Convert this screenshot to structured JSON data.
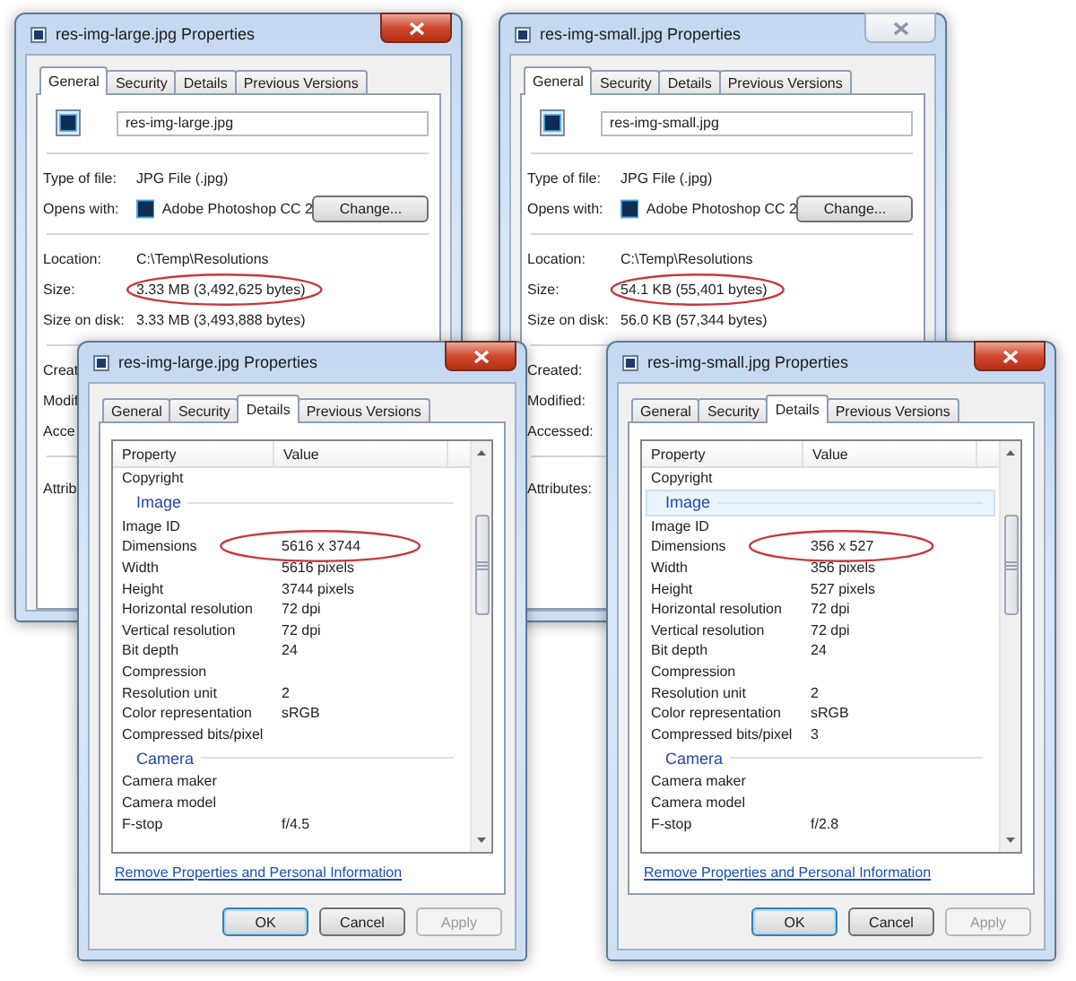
{
  "windows": [
    {
      "kind": "general",
      "title": "res-img-large.jpg Properties",
      "active": true,
      "tabs": [
        {
          "label": "General",
          "selected": true
        },
        {
          "label": "Security",
          "selected": false
        },
        {
          "label": "Details",
          "selected": false
        },
        {
          "label": "Previous Versions",
          "selected": false
        }
      ],
      "file_name": "res-img-large.jpg",
      "sections": [
        {
          "rows": [
            {
              "kind": "text",
              "label": "Type of file:",
              "value": "JPG File (.jpg)",
              "circled": false
            },
            {
              "kind": "app",
              "label": "Opens with:",
              "value": "Adobe Photoshop CC 2",
              "button": "Change..."
            }
          ]
        },
        {
          "rows": [
            {
              "kind": "text",
              "label": "Location:",
              "value": "C:\\Temp\\Resolutions",
              "circled": false
            },
            {
              "kind": "text",
              "label": "Size:",
              "value": "3.33 MB (3,492,625 bytes)",
              "circled": true
            },
            {
              "kind": "text",
              "label": "Size on disk:",
              "value": "3.33 MB (3,493,888 bytes)",
              "circled": false
            }
          ]
        },
        {
          "rows": [
            {
              "kind": "label",
              "label": "Creat"
            },
            {
              "kind": "label",
              "label": "Modif"
            },
            {
              "kind": "label",
              "label": "Acce"
            }
          ]
        },
        {
          "rows": [
            {
              "kind": "label",
              "label": "Attrib"
            }
          ]
        }
      ]
    },
    {
      "kind": "general",
      "title": "res-img-small.jpg Properties",
      "active": false,
      "tabs": [
        {
          "label": "General",
          "selected": true
        },
        {
          "label": "Security",
          "selected": false
        },
        {
          "label": "Details",
          "selected": false
        },
        {
          "label": "Previous Versions",
          "selected": false
        }
      ],
      "file_name": "res-img-small.jpg",
      "sections": [
        {
          "rows": [
            {
              "kind": "text",
              "label": "Type of file:",
              "value": "JPG File (.jpg)",
              "circled": false
            },
            {
              "kind": "app",
              "label": "Opens with:",
              "value": "Adobe Photoshop CC 2",
              "button": "Change..."
            }
          ]
        },
        {
          "rows": [
            {
              "kind": "text",
              "label": "Location:",
              "value": "C:\\Temp\\Resolutions",
              "circled": false
            },
            {
              "kind": "text",
              "label": "Size:",
              "value": "54.1 KB (55,401 bytes)",
              "circled": true
            },
            {
              "kind": "text",
              "label": "Size on disk:",
              "value": "56.0 KB (57,344 bytes)",
              "circled": false
            }
          ]
        },
        {
          "rows": [
            {
              "kind": "label",
              "label": "Created:"
            },
            {
              "kind": "label",
              "label": "Modified:"
            },
            {
              "kind": "label",
              "label": "Accessed:"
            }
          ]
        },
        {
          "rows": [
            {
              "kind": "label",
              "label": "Attributes:"
            }
          ]
        }
      ]
    },
    {
      "kind": "details",
      "title": "res-img-large.jpg Properties",
      "active": true,
      "tabs": [
        {
          "label": "General",
          "selected": false
        },
        {
          "label": "Security",
          "selected": false
        },
        {
          "label": "Details",
          "selected": true
        },
        {
          "label": "Previous Versions",
          "selected": false
        }
      ],
      "columns": [
        "Property",
        "Value"
      ],
      "rows": [
        {
          "kind": "row",
          "name": "Copyright",
          "selected": false,
          "circled": false
        },
        {
          "kind": "group",
          "name": "Image",
          "selected": false
        },
        {
          "kind": "row",
          "name": "Image ID",
          "selected": false,
          "circled": false
        },
        {
          "kind": "row",
          "name": "Dimensions",
          "value": "5616 x 3744",
          "selected": false,
          "circled": true
        },
        {
          "kind": "row",
          "name": "Width",
          "value": "5616 pixels",
          "selected": false,
          "circled": false
        },
        {
          "kind": "row",
          "name": "Height",
          "value": "3744 pixels",
          "selected": false,
          "circled": false
        },
        {
          "kind": "row",
          "name": "Horizontal resolution",
          "value": "72 dpi",
          "selected": false,
          "circled": false
        },
        {
          "kind": "row",
          "name": "Vertical resolution",
          "value": "72 dpi",
          "selected": false,
          "circled": false
        },
        {
          "kind": "row",
          "name": "Bit depth",
          "value": "24",
          "selected": false,
          "circled": false
        },
        {
          "kind": "row",
          "name": "Compression",
          "selected": false,
          "circled": false
        },
        {
          "kind": "row",
          "name": "Resolution unit",
          "value": "2",
          "selected": false,
          "circled": false
        },
        {
          "kind": "row",
          "name": "Color representation",
          "value": "sRGB",
          "selected": false,
          "circled": false
        },
        {
          "kind": "row",
          "name": "Compressed bits/pixel",
          "selected": false,
          "circled": false
        },
        {
          "kind": "group",
          "name": "Camera",
          "selected": false
        },
        {
          "kind": "row",
          "name": "Camera maker",
          "selected": false,
          "circled": false
        },
        {
          "kind": "row",
          "name": "Camera model",
          "selected": false,
          "circled": false
        },
        {
          "kind": "row",
          "name": "F-stop",
          "value": "f/4.5",
          "selected": false,
          "circled": false
        }
      ],
      "link": "Remove Properties and Personal Information",
      "buttons": [
        {
          "label": "OK",
          "default": true,
          "disabled": false
        },
        {
          "label": "Cancel",
          "default": false,
          "disabled": false
        },
        {
          "label": "Apply",
          "default": false,
          "disabled": true
        }
      ]
    },
    {
      "kind": "details",
      "title": "res-img-small.jpg Properties",
      "active": true,
      "tabs": [
        {
          "label": "General",
          "selected": false
        },
        {
          "label": "Security",
          "selected": false
        },
        {
          "label": "Details",
          "selected": true
        },
        {
          "label": "Previous Versions",
          "selected": false
        }
      ],
      "columns": [
        "Property",
        "Value"
      ],
      "rows": [
        {
          "kind": "row",
          "name": "Copyright",
          "selected": false,
          "circled": false
        },
        {
          "kind": "group",
          "name": "Image",
          "selected": true
        },
        {
          "kind": "row",
          "name": "Image ID",
          "selected": false,
          "circled": false
        },
        {
          "kind": "row",
          "name": "Dimensions",
          "value": "356 x 527",
          "selected": false,
          "circled": true
        },
        {
          "kind": "row",
          "name": "Width",
          "value": "356 pixels",
          "selected": false,
          "circled": false
        },
        {
          "kind": "row",
          "name": "Height",
          "value": "527 pixels",
          "selected": false,
          "circled": false
        },
        {
          "kind": "row",
          "name": "Horizontal resolution",
          "value": "72 dpi",
          "selected": false,
          "circled": false
        },
        {
          "kind": "row",
          "name": "Vertical resolution",
          "value": "72 dpi",
          "selected": false,
          "circled": false
        },
        {
          "kind": "row",
          "name": "Bit depth",
          "value": "24",
          "selected": false,
          "circled": false
        },
        {
          "kind": "row",
          "name": "Compression",
          "selected": false,
          "circled": false
        },
        {
          "kind": "row",
          "name": "Resolution unit",
          "value": "2",
          "selected": false,
          "circled": false
        },
        {
          "kind": "row",
          "name": "Color representation",
          "value": "sRGB",
          "selected": false,
          "circled": false
        },
        {
          "kind": "row",
          "name": "Compressed bits/pixel",
          "value": "3",
          "selected": false,
          "circled": false
        },
        {
          "kind": "group",
          "name": "Camera",
          "selected": false
        },
        {
          "kind": "row",
          "name": "Camera maker",
          "selected": false,
          "circled": false
        },
        {
          "kind": "row",
          "name": "Camera model",
          "selected": false,
          "circled": false
        },
        {
          "kind": "row",
          "name": "F-stop",
          "value": "f/2.8",
          "selected": false,
          "circled": false
        }
      ],
      "link": "Remove Properties and Personal Information",
      "buttons": [
        {
          "label": "OK",
          "default": true,
          "disabled": false
        },
        {
          "label": "Cancel",
          "default": false,
          "disabled": false
        },
        {
          "label": "Apply",
          "default": false,
          "disabled": true
        }
      ]
    }
  ]
}
